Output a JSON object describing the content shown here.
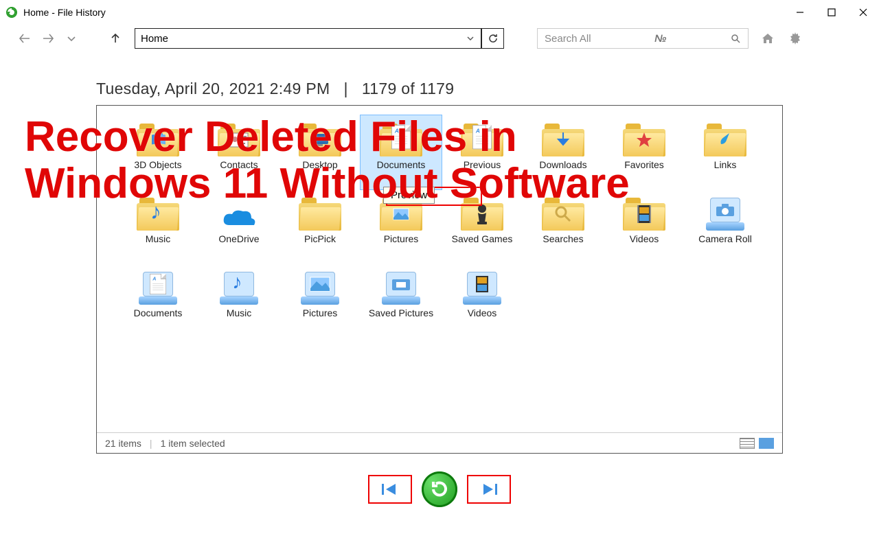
{
  "window": {
    "title": "Home - File History"
  },
  "nav": {
    "address": "Home",
    "search_placeholder": "Search All"
  },
  "header": {
    "timestamp": "Tuesday, April 20, 2021 2:49 PM",
    "position": "1179 of 1179"
  },
  "items": {
    "row1": [
      {
        "label": "3D Objects"
      },
      {
        "label": "Contacts"
      },
      {
        "label": "Desktop"
      },
      {
        "label": "Documents"
      },
      {
        "label": "Previous"
      },
      {
        "label": "Downloads"
      },
      {
        "label": "Favorites"
      },
      {
        "label": "Links"
      }
    ],
    "row2": [
      {
        "label": "Music"
      },
      {
        "label": "OneDrive"
      },
      {
        "label": "PicPick"
      },
      {
        "label": "Pictures"
      },
      {
        "label": "Saved Games"
      },
      {
        "label": "Searches"
      },
      {
        "label": "Videos"
      },
      {
        "label": "Camera Roll"
      }
    ],
    "row3": [
      {
        "label": "Documents"
      },
      {
        "label": "Music"
      },
      {
        "label": "Pictures"
      },
      {
        "label": "Saved Pictures"
      },
      {
        "label": "Videos"
      }
    ]
  },
  "tooltip": "Preview",
  "status": {
    "count": "21 items",
    "selected": "1 item selected"
  },
  "overlay": {
    "line1": "Recover Deleted Files in",
    "line2": "Windows 11 Without Software"
  }
}
